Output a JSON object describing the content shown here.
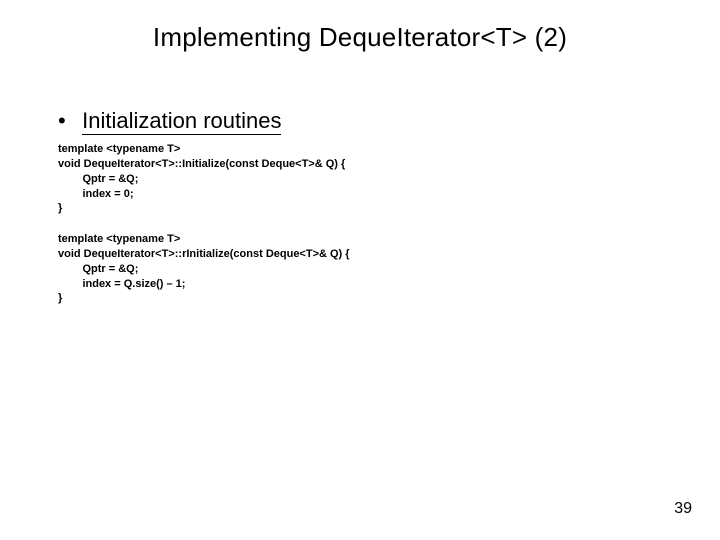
{
  "title": "Implementing DequeIterator<T> (2)",
  "bullet": {
    "marker": "•",
    "text": "Initialization routines"
  },
  "code1": {
    "l1": "template <typename T>",
    "l2": "void DequeIterator<T>::Initialize(const Deque<T>& Q) {",
    "l3": "        Qptr = &Q;",
    "l4": "        index = 0;",
    "l5": "}"
  },
  "code2": {
    "l1": "template <typename T>",
    "l2": "void DequeIterator<T>::rInitialize(const Deque<T>& Q) {",
    "l3": "        Qptr = &Q;",
    "l4": "        index = Q.size() – 1;",
    "l5": "}"
  },
  "pagenum": "39"
}
